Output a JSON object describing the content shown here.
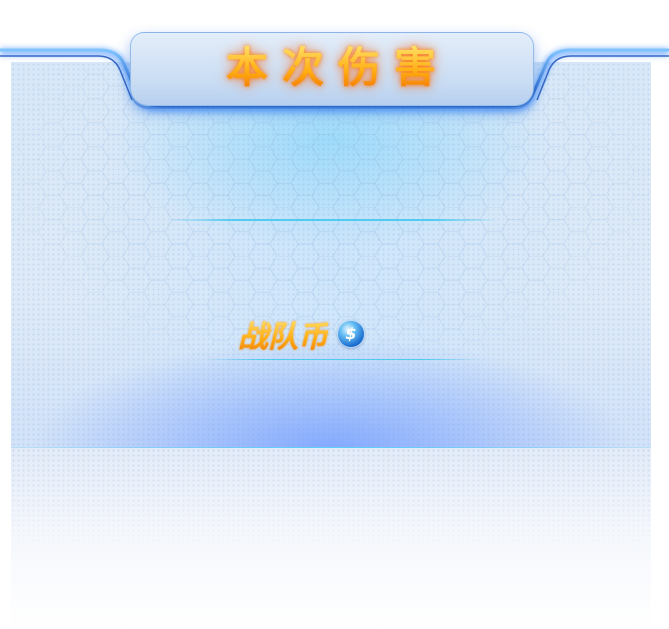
{
  "header": {
    "title": "本次伤害"
  },
  "reward": {
    "currency_label": "战队币",
    "coin_icon": "coin-icon"
  },
  "colors": {
    "title_gold": "#ffae12",
    "accent_cyan": "#46c8f0",
    "frame_blue": "#1d6fd2",
    "panel_base": "#d7e7f7"
  }
}
